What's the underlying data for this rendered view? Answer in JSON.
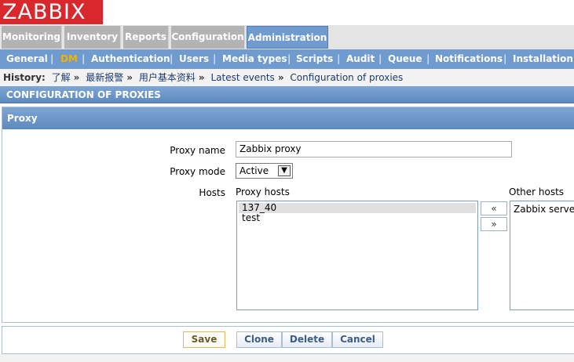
{
  "logo": "ZABBIX",
  "main_menu": [
    "Monitoring",
    "Inventory",
    "Reports",
    "Configuration",
    "Administration"
  ],
  "sub_menu": [
    "General",
    "DM",
    "Authentication",
    "Users",
    "Media types",
    "Scripts",
    "Audit",
    "Queue",
    "Notifications",
    "Installation"
  ],
  "history": {
    "label": "History:",
    "items": [
      "了解",
      "最新报警",
      "用户基本资料",
      "Latest events",
      "Configuration of proxies"
    ],
    "separator": "»"
  },
  "page_title": "CONFIGURATION OF PROXIES",
  "form_title": "Proxy",
  "form": {
    "proxy_name_label": "Proxy name",
    "proxy_name_value": "Zabbix proxy",
    "proxy_mode_label": "Proxy mode",
    "proxy_mode_value": "Active",
    "hosts_label": "Hosts",
    "proxy_hosts_label": "Proxy hosts",
    "other_hosts_label": "Other hosts",
    "proxy_hosts": [
      "137_40",
      "test"
    ],
    "other_hosts": [
      "Zabbix server"
    ],
    "move_left": "«",
    "move_right": "»"
  },
  "buttons": {
    "save": "Save",
    "clone": "Clone",
    "delete": "Delete",
    "cancel": "Cancel"
  },
  "colors": {
    "logo_bg": "#d8282d",
    "menu_active": "#6f9bcf",
    "submenu_selected": "#f0b400"
  }
}
